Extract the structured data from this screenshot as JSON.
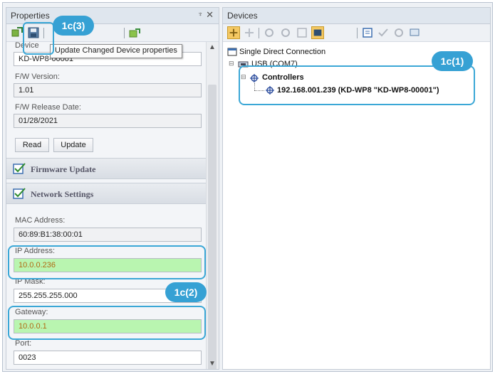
{
  "properties_panel": {
    "title": "Properties",
    "pin_glyph": "♆",
    "close_glyph": "✕",
    "tooltip": "Update Changed Device properties",
    "device_label": "Device",
    "device_value": "KD-WP8-00001",
    "fw_version_label": "F/W Version:",
    "fw_version_value": "1.01",
    "fw_release_label": "F/W Release Date:",
    "fw_release_value": "01/28/2021",
    "read_button": "Read",
    "update_button": "Update",
    "firmware_section": "Firmware Update",
    "network_section": "Network Settings",
    "mac_label": "MAC Address:",
    "mac_value": "60:89:B1:38:00:01",
    "ip_label": "IP Address:",
    "ip_value": "10.0.0.236",
    "mask_label": "IP Mask:",
    "mask_value": "255.255.255.000",
    "gateway_label": "Gateway:",
    "gateway_value": "10.0.0.1",
    "port_label": "Port:",
    "port_value": "0023"
  },
  "devices_panel": {
    "title": "Devices",
    "tree": {
      "root": "Single Direct Connection",
      "usb": "USB (COM7)",
      "controllers": "Controllers",
      "device": "192.168.001.239 (KD-WP8 \"KD-WP8-00001\")"
    }
  },
  "callouts": {
    "save": "1c(3)",
    "tree": "1c(1)",
    "network": "1c(2)"
  },
  "colors": {
    "highlight": "#3ba7d6",
    "changed_field": "#b9f5b0"
  }
}
